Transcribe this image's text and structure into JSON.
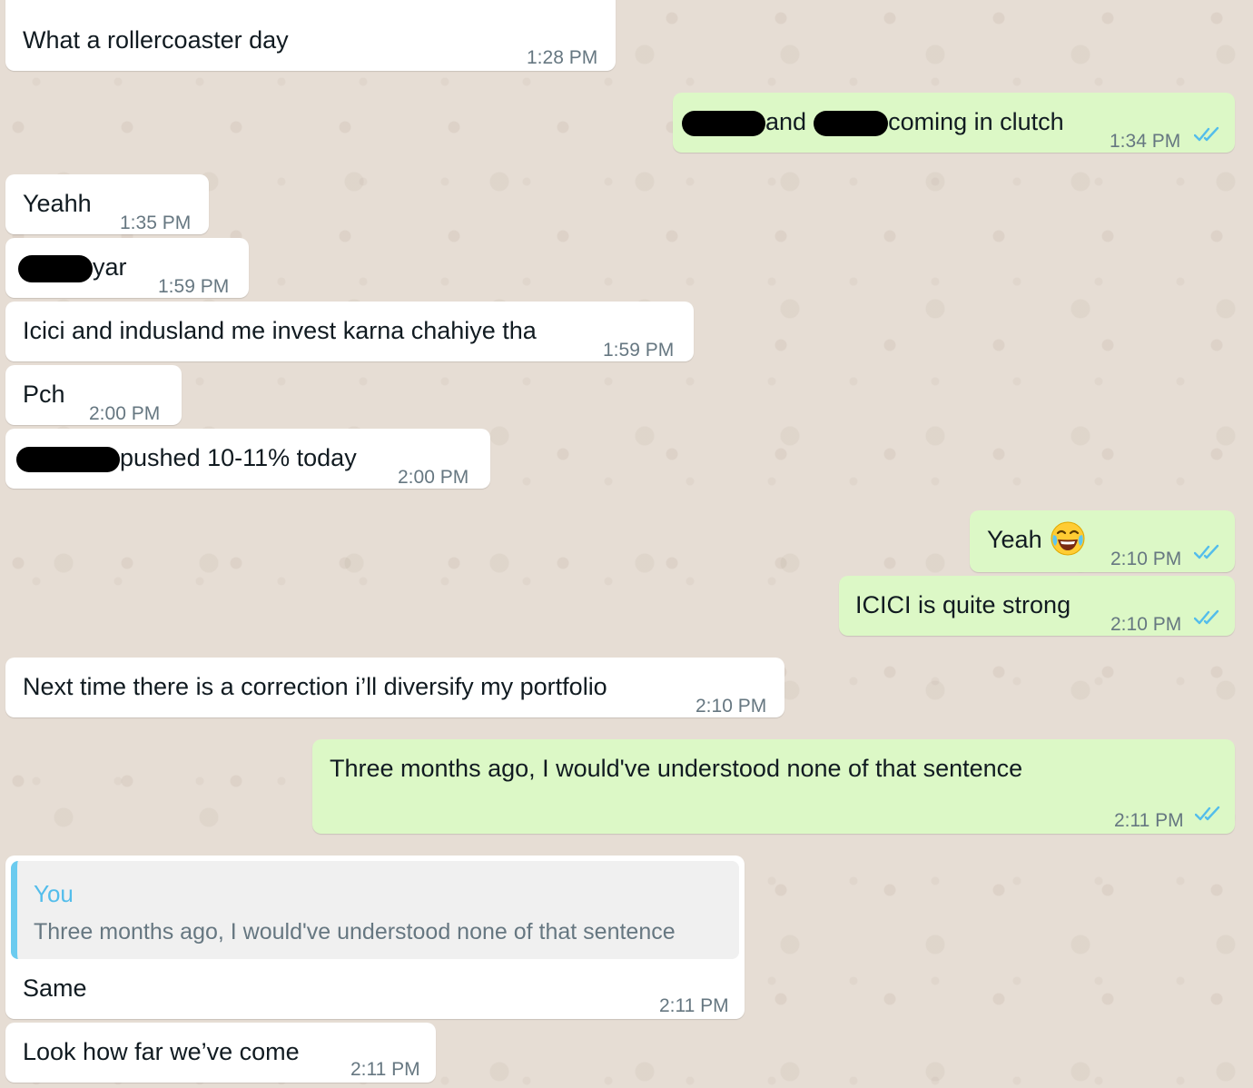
{
  "theme": {
    "incoming_bubble": "#ffffff",
    "outgoing_bubble": "#dcf8c6",
    "read_ticks": "#53bdeb",
    "timestamp_color": "#667781",
    "quote_bar": "#6bcbef",
    "quote_author": "#53bdeb",
    "wallpaper": "#e6ddd4"
  },
  "messages": [
    {
      "direction": "incoming",
      "text": "What a rollercoaster day",
      "time": "1:28 PM"
    },
    {
      "direction": "outgoing",
      "part1": "and",
      "part2": "coming in clutch",
      "time": "1:34 PM",
      "status_icon": "double-check-read"
    },
    {
      "direction": "incoming",
      "text": "Yeahh",
      "time": "1:35 PM"
    },
    {
      "direction": "incoming",
      "text": "yar",
      "time": "1:59 PM"
    },
    {
      "direction": "incoming",
      "text": "Icici and indusland me invest karna chahiye tha",
      "time": "1:59 PM"
    },
    {
      "direction": "incoming",
      "text": "Pch",
      "time": "2:00 PM"
    },
    {
      "direction": "incoming",
      "text": "pushed 10-11% today",
      "time": "2:00 PM"
    },
    {
      "direction": "outgoing",
      "text": "Yeah",
      "emoji": "face-with-tears-of-joy",
      "time": "2:10 PM",
      "status_icon": "double-check-read"
    },
    {
      "direction": "outgoing",
      "text": "ICICI is quite strong",
      "time": "2:10 PM",
      "status_icon": "double-check-read"
    },
    {
      "direction": "incoming",
      "text": "Next time there is a correction i’ll diversify my portfolio",
      "time": "2:10 PM"
    },
    {
      "direction": "outgoing",
      "text": "Three months ago, I would've understood none of that sentence",
      "time": "2:11 PM",
      "status_icon": "double-check-read"
    },
    {
      "direction": "incoming",
      "quote_author": "You",
      "quote_text": "Three months ago, I would've understood none of that sentence",
      "text": "Same",
      "time": "2:11 PM"
    },
    {
      "direction": "incoming",
      "text": "Look how far we’ve come",
      "time": "2:11 PM"
    }
  ]
}
